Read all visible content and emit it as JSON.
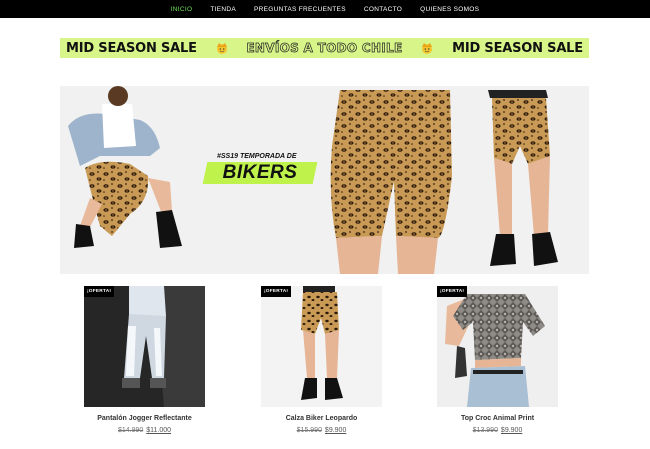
{
  "nav": {
    "items": [
      {
        "label": "INICIO",
        "active": true
      },
      {
        "label": "TIENDA",
        "active": false
      },
      {
        "label": "PREGUNTAS FRECUENTES",
        "active": false
      },
      {
        "label": "CONTACTO",
        "active": false
      },
      {
        "label": "QUIENES SOMOS",
        "active": false
      }
    ]
  },
  "banner": {
    "left_text": "MID SEASON SALE",
    "center_text": "ENVÍOS A TODO CHILE",
    "right_text": "MID SEASON SALE",
    "background": "#d8f58a"
  },
  "hero": {
    "tagline": "#SS19 TEMPORADA DE",
    "title": "BIKERS",
    "accent": "#bff24a"
  },
  "products": [
    {
      "badge": "¡OFERTA!",
      "name": "Pantalón Jogger Reflectante",
      "old_price": "$14.990",
      "new_price": "$11.000"
    },
    {
      "badge": "¡OFERTA!",
      "name": "Calza Biker Leopardo",
      "old_price": "$15.990",
      "new_price": "$9.900"
    },
    {
      "badge": "¡OFERTA!",
      "name": "Top Croc Animal Print",
      "old_price": "$13.990",
      "new_price": "$9.900"
    }
  ],
  "colors": {
    "nav_bg": "#000000",
    "nav_active": "#6ee05a"
  }
}
